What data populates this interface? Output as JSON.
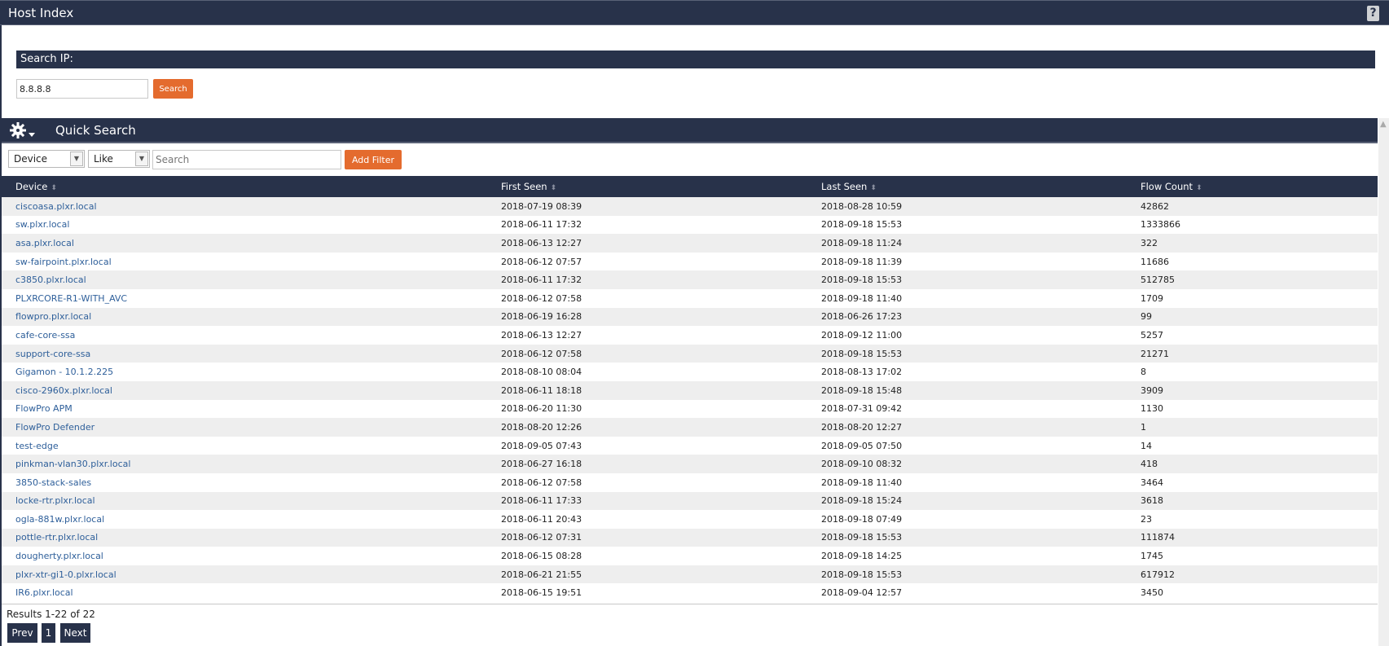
{
  "header": {
    "title": "Host Index",
    "help_icon": "?"
  },
  "search_ip": {
    "label": "Search IP:",
    "value": "8.8.8.8",
    "button_label": "Search"
  },
  "quick_search": {
    "title": "Quick Search",
    "gear_icon": "gear-menu",
    "field_select": "Device",
    "operator_select": "Like",
    "filter_placeholder": "Search",
    "add_filter_label": "Add Filter"
  },
  "table": {
    "columns": [
      "Device",
      "First Seen",
      "Last Seen",
      "Flow Count"
    ],
    "rows": [
      [
        "ciscoasa.plxr.local",
        "2018-07-19 08:39",
        "2018-08-28 10:59",
        "42862"
      ],
      [
        "sw.plxr.local",
        "2018-06-11 17:32",
        "2018-09-18 15:53",
        "1333866"
      ],
      [
        "asa.plxr.local",
        "2018-06-13 12:27",
        "2018-09-18 11:24",
        "322"
      ],
      [
        "sw-fairpoint.plxr.local",
        "2018-06-12 07:57",
        "2018-09-18 11:39",
        "11686"
      ],
      [
        "c3850.plxr.local",
        "2018-06-11 17:32",
        "2018-09-18 15:53",
        "512785"
      ],
      [
        "PLXRCORE-R1-WITH_AVC",
        "2018-06-12 07:58",
        "2018-09-18 11:40",
        "1709"
      ],
      [
        "flowpro.plxr.local",
        "2018-06-19 16:28",
        "2018-06-26 17:23",
        "99"
      ],
      [
        "cafe-core-ssa",
        "2018-06-13 12:27",
        "2018-09-12 11:00",
        "5257"
      ],
      [
        "support-core-ssa",
        "2018-06-12 07:58",
        "2018-09-18 15:53",
        "21271"
      ],
      [
        "Gigamon - 10.1.2.225",
        "2018-08-10 08:04",
        "2018-08-13 17:02",
        "8"
      ],
      [
        "cisco-2960x.plxr.local",
        "2018-06-11 18:18",
        "2018-09-18 15:48",
        "3909"
      ],
      [
        "FlowPro APM",
        "2018-06-20 11:30",
        "2018-07-31 09:42",
        "1130"
      ],
      [
        "FlowPro Defender",
        "2018-08-20 12:26",
        "2018-08-20 12:27",
        "1"
      ],
      [
        "test-edge",
        "2018-09-05 07:43",
        "2018-09-05 07:50",
        "14"
      ],
      [
        "pinkman-vlan30.plxr.local",
        "2018-06-27 16:18",
        "2018-09-10 08:32",
        "418"
      ],
      [
        "3850-stack-sales",
        "2018-06-12 07:58",
        "2018-09-18 11:40",
        "3464"
      ],
      [
        "locke-rtr.plxr.local",
        "2018-06-11 17:33",
        "2018-09-18 15:24",
        "3618"
      ],
      [
        "ogla-881w.plxr.local",
        "2018-06-11 20:43",
        "2018-09-18 07:49",
        "23"
      ],
      [
        "pottle-rtr.plxr.local",
        "2018-06-12 07:31",
        "2018-09-18 15:53",
        "111874"
      ],
      [
        "dougherty.plxr.local",
        "2018-06-15 08:28",
        "2018-09-18 14:25",
        "1745"
      ],
      [
        "plxr-xtr-gi1-0.plxr.local",
        "2018-06-21 21:55",
        "2018-09-18 15:53",
        "617912"
      ],
      [
        "IR6.plxr.local",
        "2018-06-15 19:51",
        "2018-09-04 12:57",
        "3450"
      ]
    ]
  },
  "pagination": {
    "results_text": "Results 1-22 of 22",
    "prev_label": "Prev",
    "page_label": "1",
    "next_label": "Next"
  },
  "colors": {
    "header_bg": "#28324a",
    "accent_orange": "#e46b2e",
    "link": "#2e5f9a",
    "row_alt": "#eeeeee"
  }
}
